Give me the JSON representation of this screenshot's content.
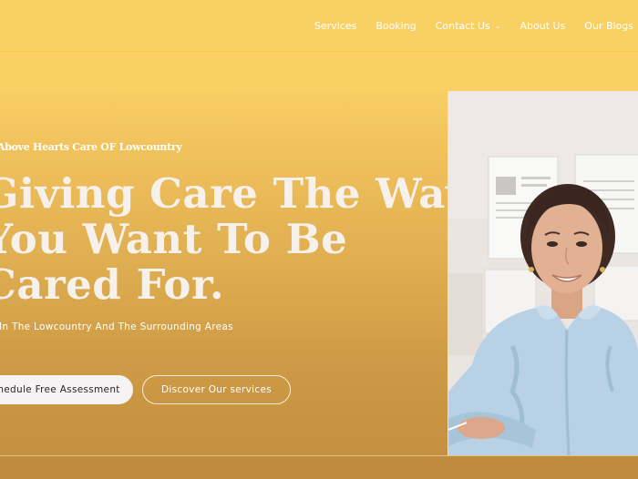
{
  "nav": {
    "items": [
      {
        "label": "Services"
      },
      {
        "label": "Booking"
      },
      {
        "label": "Contact Us"
      },
      {
        "label": "About Us"
      },
      {
        "label": "Our Blogs"
      }
    ]
  },
  "hero": {
    "eyebrow": "Above Hearts Care OF Lowcountry",
    "headline_lines": [
      "Giving Care The Way",
      "You Want To Be",
      "Cared For."
    ],
    "subtitle": "In The Lowcountry And The Surrounding Areas",
    "primary_button": "Schedule Free Assessment",
    "secondary_button": "Discover Our services"
  },
  "colors": {
    "header": "#f9d064",
    "hero_top": "#f8ce63",
    "hero_bottom": "#c59040",
    "button_light": "#f6f3f4",
    "text_light": "#ffffff"
  }
}
